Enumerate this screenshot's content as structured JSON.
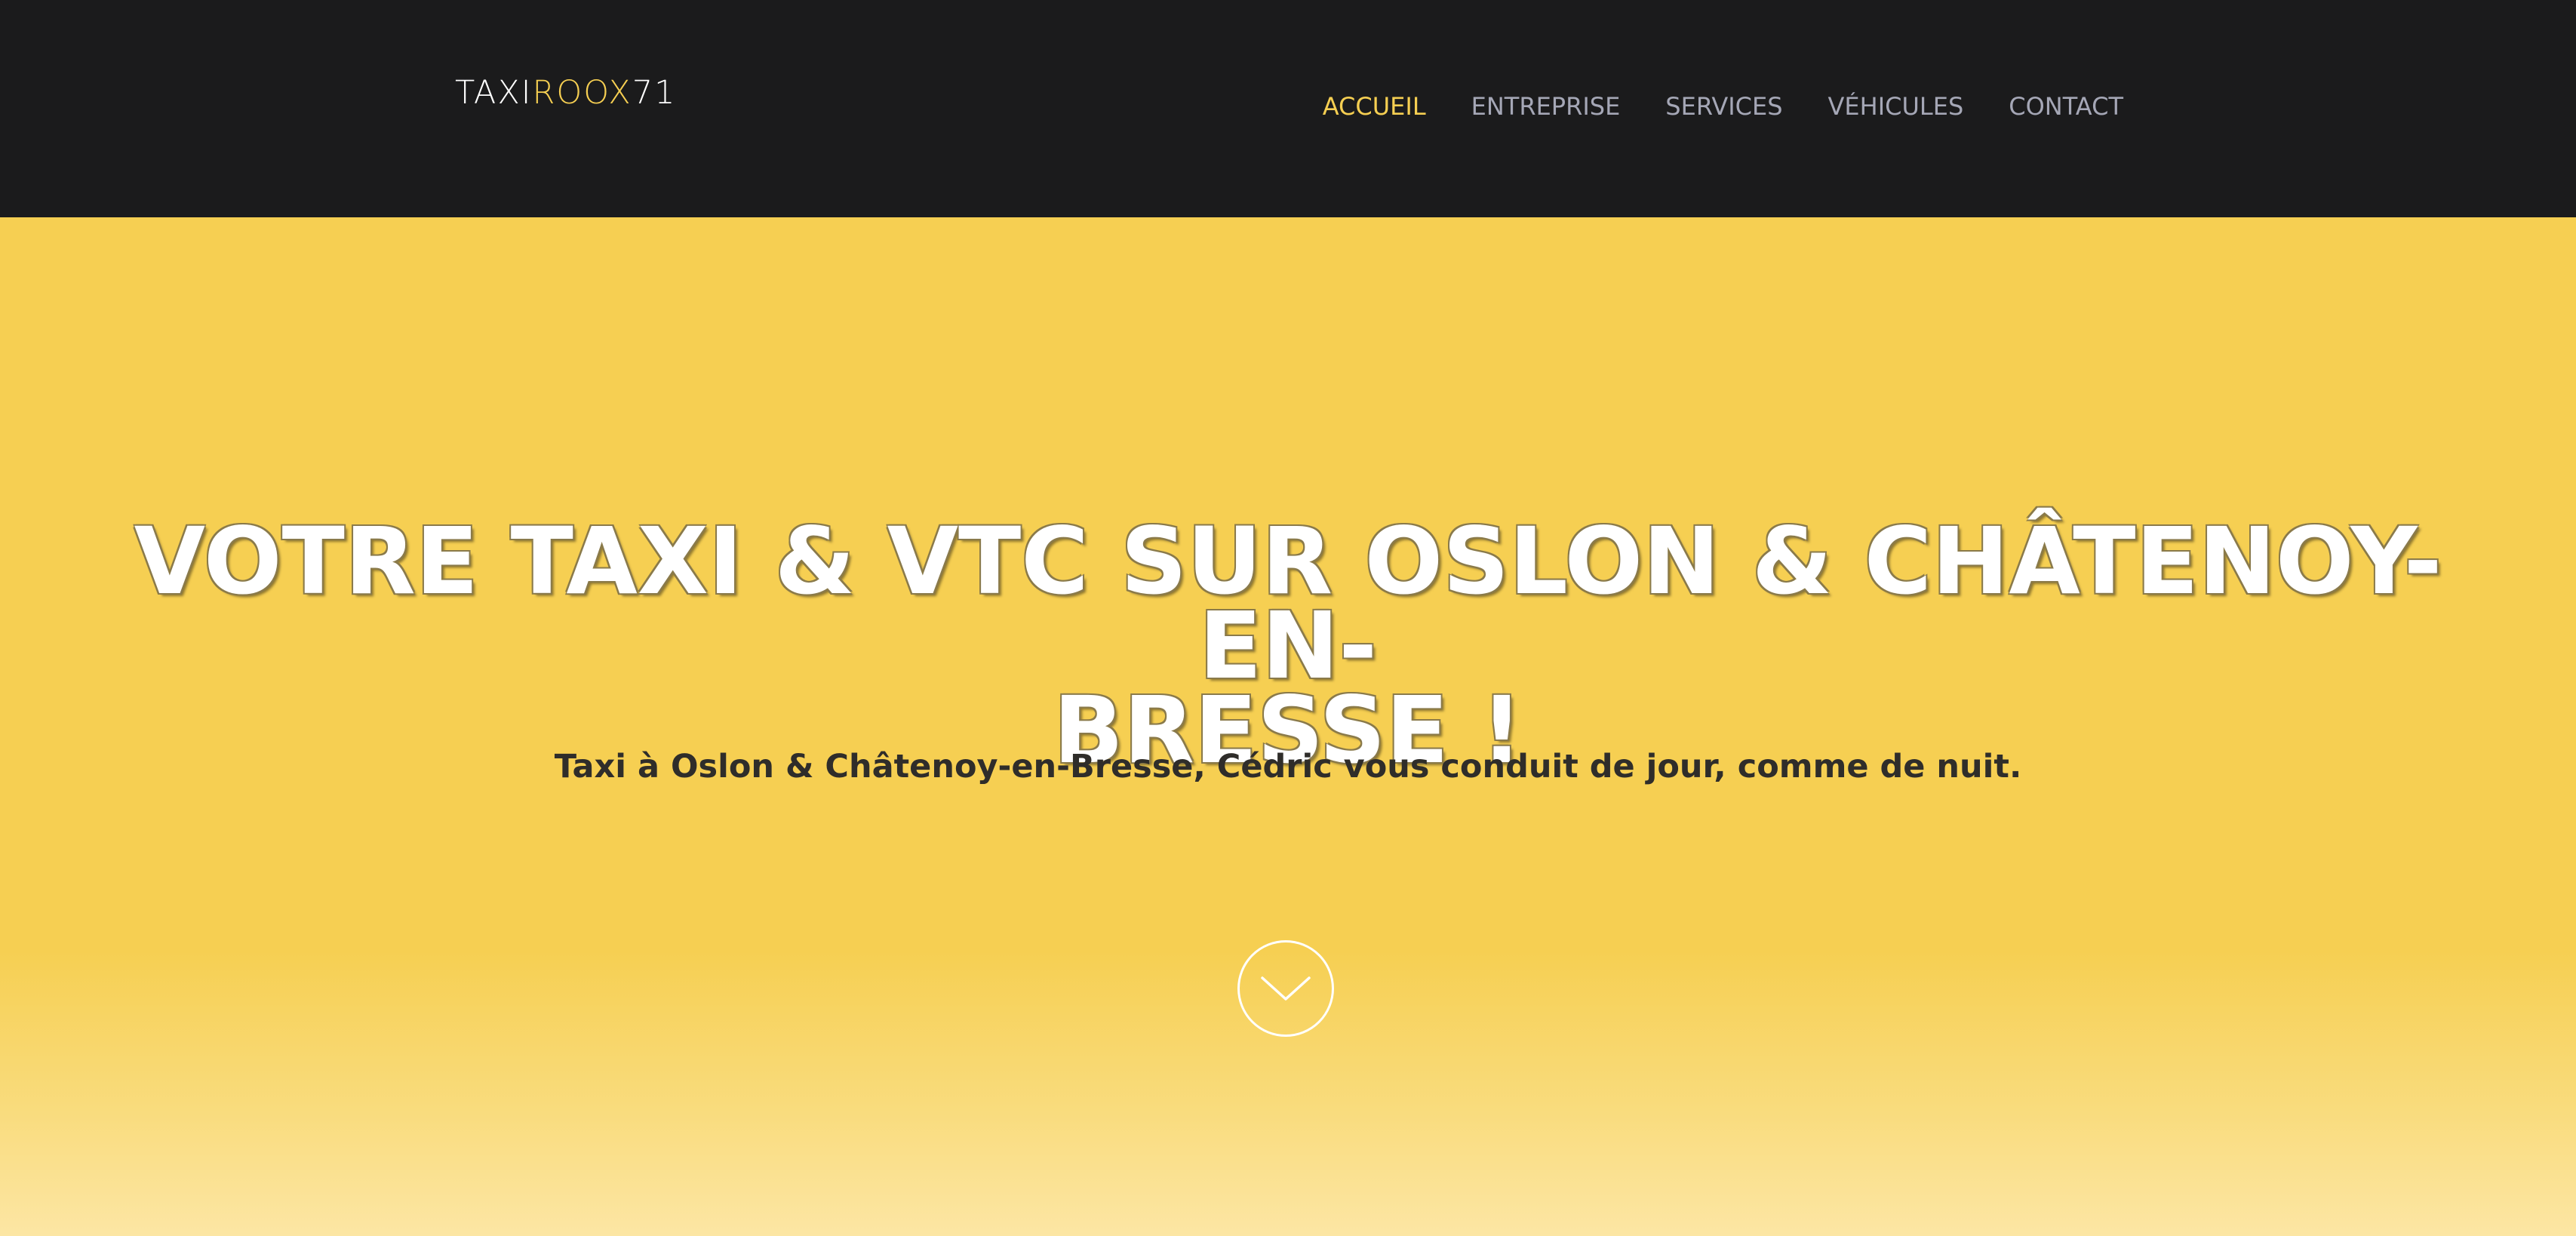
{
  "header": {
    "logo": {
      "part1": "TAXI",
      "part2": "ROOX",
      "part3": "71"
    },
    "nav": [
      {
        "label": "ACCUEIL",
        "active": true
      },
      {
        "label": "ENTREPRISE",
        "active": false
      },
      {
        "label": "SERVICES",
        "active": false
      },
      {
        "label": "VÉHICULES",
        "active": false
      },
      {
        "label": "CONTACT",
        "active": false
      }
    ]
  },
  "hero": {
    "title_line1": "VOTRE TAXI & VTC SUR OSLON & CHÂTENOY-EN-",
    "title_line2": "BRESSE !",
    "subtitle": "Taxi à Oslon & Châtenoy-en-Bresse, Cédric vous conduit de jour, comme de nuit.",
    "scroll_icon": "chevron-down-circle-icon"
  },
  "colors": {
    "header_bg": "#1b1b1c",
    "accent": "#f6cf52",
    "nav_text": "#a5a7b6",
    "subtitle_text": "#2f2d2a"
  }
}
